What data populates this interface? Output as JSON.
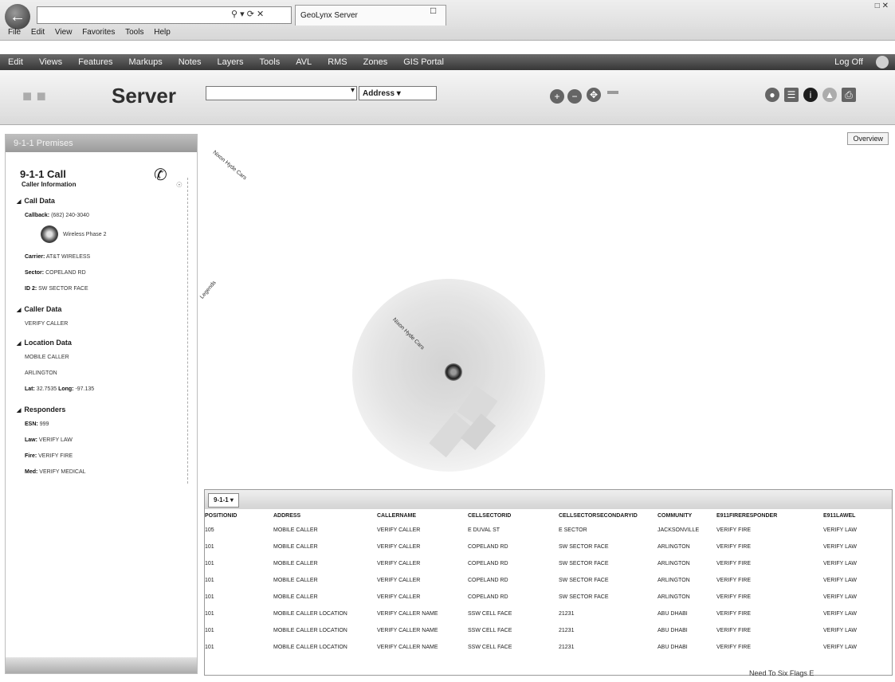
{
  "browser": {
    "address": "",
    "tab_title": "GeoLynx Server",
    "menu": [
      "File",
      "Edit",
      "View",
      "Favorites",
      "Tools",
      "Help"
    ]
  },
  "app_nav": {
    "items": [
      "Edit",
      "Views",
      "Features",
      "Markups",
      "Notes",
      "Layers",
      "Tools",
      "AVL",
      "RMS",
      "Zones",
      "GIS Portal"
    ],
    "logout": "Log Off"
  },
  "header": {
    "logo_text": "Server",
    "search_placeholder": "",
    "search_type": "Address"
  },
  "panel": {
    "title": "9-1-1 Premises",
    "call_title": "9-1-1 Call",
    "caller_info_title": "Caller Information",
    "sections": {
      "call_data": "Call Data",
      "caller_data": "Caller Data",
      "location_data": "Location Data",
      "responders": "Responders"
    },
    "callback_label": "Callback:",
    "callback_value": "(682) 240-3040",
    "phase": "Wireless Phase 2",
    "carrier_label": "Carrier:",
    "carrier_value": "AT&T WIRELESS",
    "sector_label": "Sector:",
    "sector_value": "COPELAND RD",
    "id_label": "ID 2:",
    "id_value": "SW SECTOR FACE",
    "caller_value": "VERIFY CALLER",
    "location_line1": "MOBILE CALLER",
    "location_line2": "ARLINGTON",
    "lat_label": "Lat:",
    "lat_value": "32.7535",
    "long_label": "Long:",
    "long_value": "-97.135",
    "esn_label": "ESN:",
    "esn_value": "999",
    "law_label": "Law:",
    "law_value": "VERIFY LAW",
    "fire_label": "Fire:",
    "fire_value": "VERIFY FIRE",
    "med_label": "Med:",
    "med_value": "VERIFY MEDICAL"
  },
  "map": {
    "overview": "Overview",
    "label_top": "Nixon Hyde Cars",
    "label_mid": "Legends",
    "label_center": "Nixon Hyde Cars"
  },
  "table": {
    "tab_label": "9-1-1",
    "columns": [
      "POSITIONID",
      "ADDRESS",
      "CALLERNAME",
      "CELLSECTORID",
      "CELLSECTORSECONDARYID",
      "COMMUNITY",
      "E911FIRERESPONDER",
      "E911LAWEL"
    ],
    "rows": [
      [
        "105",
        "MOBILE CALLER",
        "VERIFY CALLER",
        "E DUVAL ST",
        "E SECTOR",
        "JACKSONVILLE",
        "VERIFY FIRE",
        "VERIFY LAW"
      ],
      [
        "101",
        "MOBILE CALLER",
        "VERIFY CALLER",
        "COPELAND RD",
        "SW SECTOR FACE",
        "ARLINGTON",
        "VERIFY FIRE",
        "VERIFY LAW"
      ],
      [
        "101",
        "MOBILE CALLER",
        "VERIFY CALLER",
        "COPELAND RD",
        "SW SECTOR FACE",
        "ARLINGTON",
        "VERIFY FIRE",
        "VERIFY LAW"
      ],
      [
        "101",
        "MOBILE CALLER",
        "VERIFY CALLER",
        "COPELAND RD",
        "SW SECTOR FACE",
        "ARLINGTON",
        "VERIFY FIRE",
        "VERIFY LAW"
      ],
      [
        "101",
        "MOBILE CALLER",
        "VERIFY CALLER",
        "COPELAND RD",
        "SW SECTOR FACE",
        "ARLINGTON",
        "VERIFY FIRE",
        "VERIFY LAW"
      ],
      [
        "101",
        "MOBILE CALLER LOCATION",
        "VERIFY CALLER NAME",
        "SSW CELL FACE",
        "21231",
        "ABU DHABI",
        "VERIFY FIRE",
        "VERIFY LAW"
      ],
      [
        "101",
        "MOBILE CALLER LOCATION",
        "VERIFY CALLER NAME",
        "SSW CELL FACE",
        "21231",
        "ABU DHABI",
        "VERIFY FIRE",
        "VERIFY LAW"
      ],
      [
        "101",
        "MOBILE CALLER LOCATION",
        "VERIFY CALLER NAME",
        "SSW CELL FACE",
        "21231",
        "ABU DHABI",
        "VERIFY FIRE",
        "VERIFY LAW"
      ]
    ]
  },
  "status": {
    "text": "Need To Six Flags E"
  }
}
